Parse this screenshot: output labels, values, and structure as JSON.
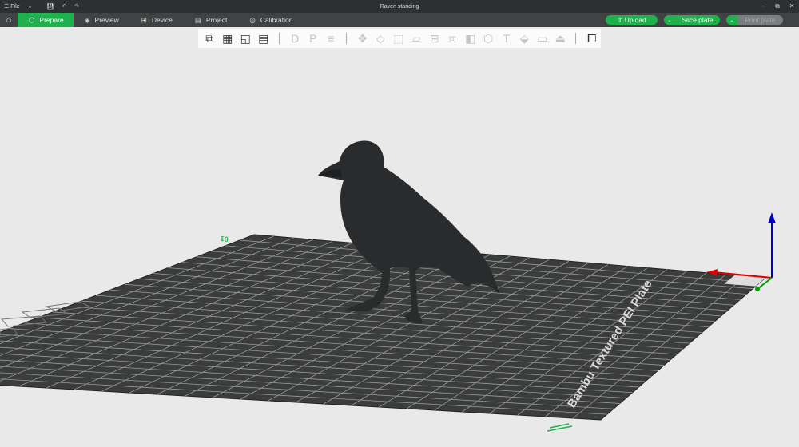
{
  "titlebar": {
    "menu_label": "File",
    "title": "Raven standing",
    "icons": [
      "menu-icon",
      "chevron-down-icon",
      "save-icon",
      "undo-icon",
      "redo-icon"
    ],
    "window_controls": [
      "minimize-icon",
      "restore-icon",
      "close-icon"
    ]
  },
  "nav": {
    "tabs": [
      {
        "label": "Prepare",
        "icon": "cube-icon",
        "active": true
      },
      {
        "label": "Preview",
        "icon": "layers-icon"
      },
      {
        "label": "Device",
        "icon": "device-icon"
      },
      {
        "label": "Project",
        "icon": "project-icon"
      },
      {
        "label": "Calibration",
        "icon": "calibration-icon"
      }
    ],
    "upload": "Upload",
    "slice": "Slice plate",
    "print": "Print plate"
  },
  "colors": {
    "accent": "#1fb14d",
    "bed": "#3b3c3c",
    "x_axis": "#e00000",
    "y_axis": "#00a000",
    "z_axis": "#0000cc"
  },
  "toolbar": {
    "tools": [
      {
        "name": "add-object-icon",
        "glyph": "⧉",
        "enabled": true
      },
      {
        "name": "add-plate-icon",
        "glyph": "▦",
        "enabled": true
      },
      {
        "name": "auto-orient-icon",
        "glyph": "◱",
        "enabled": true
      },
      {
        "name": "arrange-icon",
        "glyph": "▤",
        "enabled": true
      },
      {
        "name": "split-objects-icon",
        "glyph": "D",
        "enabled": false
      },
      {
        "name": "split-parts-icon",
        "glyph": "P",
        "enabled": false
      },
      {
        "name": "layers-icon",
        "glyph": "≡",
        "enabled": false
      },
      {
        "name": "move-icon",
        "glyph": "✥",
        "enabled": false
      },
      {
        "name": "rotate-icon",
        "glyph": "◇",
        "enabled": false
      },
      {
        "name": "scale-icon",
        "glyph": "⬚",
        "enabled": false
      },
      {
        "name": "lay-on-face-icon",
        "glyph": "⏥",
        "enabled": false
      },
      {
        "name": "cut-icon",
        "glyph": "⊟",
        "enabled": false
      },
      {
        "name": "mesh-boolean-icon",
        "glyph": "⧈",
        "enabled": false
      },
      {
        "name": "support-paint-icon",
        "glyph": "◧",
        "enabled": false
      },
      {
        "name": "seam-paint-icon",
        "glyph": "⬡",
        "enabled": false
      },
      {
        "name": "text-icon",
        "glyph": "T",
        "enabled": false
      },
      {
        "name": "color-paint-icon",
        "glyph": "⬙",
        "enabled": false
      },
      {
        "name": "measure-icon",
        "glyph": "▭",
        "enabled": false
      },
      {
        "name": "assembly-icon",
        "glyph": "⏏",
        "enabled": false
      },
      {
        "name": "variable-layer-icon",
        "glyph": "⧠",
        "enabled": true
      }
    ]
  },
  "plate": {
    "number": "01",
    "label": "Bambu Textured PEI Plate"
  }
}
